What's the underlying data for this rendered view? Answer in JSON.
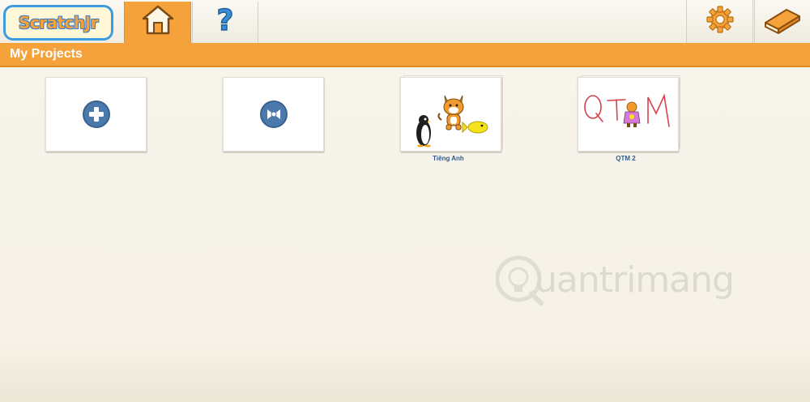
{
  "app": {
    "logo_text": "ScratchJr"
  },
  "toolbar": {
    "home_icon": "home-icon",
    "help_icon": "question-mark-icon",
    "settings_icon": "gear-icon",
    "book_icon": "book-icon"
  },
  "header": {
    "title": "My Projects"
  },
  "projects": [
    {
      "kind": "new",
      "icon": "plus-icon",
      "label": ""
    },
    {
      "kind": "sample",
      "icon": "bow-icon",
      "label": ""
    },
    {
      "kind": "project",
      "label": "Tiêng Anh"
    },
    {
      "kind": "project",
      "label": "QTM 2"
    }
  ],
  "watermark": {
    "text": "uantrimang"
  },
  "colors": {
    "accent_orange": "#f6a23a",
    "button_blue": "#4b79ac",
    "label_blue": "#2f5c8a",
    "background": "#f7f4ec"
  }
}
